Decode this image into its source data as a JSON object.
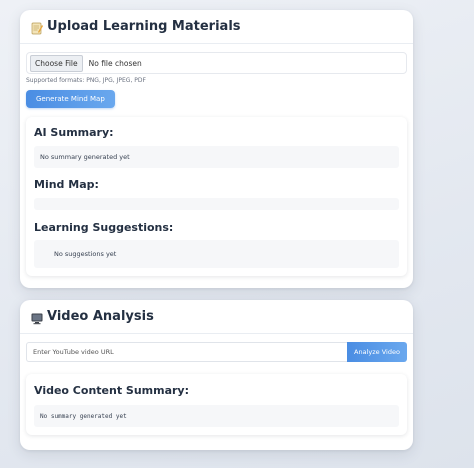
{
  "upload": {
    "title": "Upload Learning Materials",
    "icon": "memo-icon",
    "file_button": "Choose File",
    "file_status": "No file chosen",
    "formats": "Supported formats: PNG, JPG, JPEG, PDF",
    "generate_button": "Generate Mind Map"
  },
  "results": {
    "summary_title": "AI Summary:",
    "summary_text": "No summary generated yet",
    "mindmap_title": "Mind Map:",
    "suggestions_title": "Learning Suggestions:",
    "suggestions_text": "No suggestions yet"
  },
  "video": {
    "title": "Video Analysis",
    "icon": "video-monitor-icon",
    "url_placeholder": "Enter YouTube video URL",
    "analyze_button": "Analyze Video",
    "summary_title": "Video Content Summary:",
    "summary_text": "No summary generated yet"
  },
  "colors": {
    "accent": "#4a8de3",
    "title": "#243042"
  }
}
